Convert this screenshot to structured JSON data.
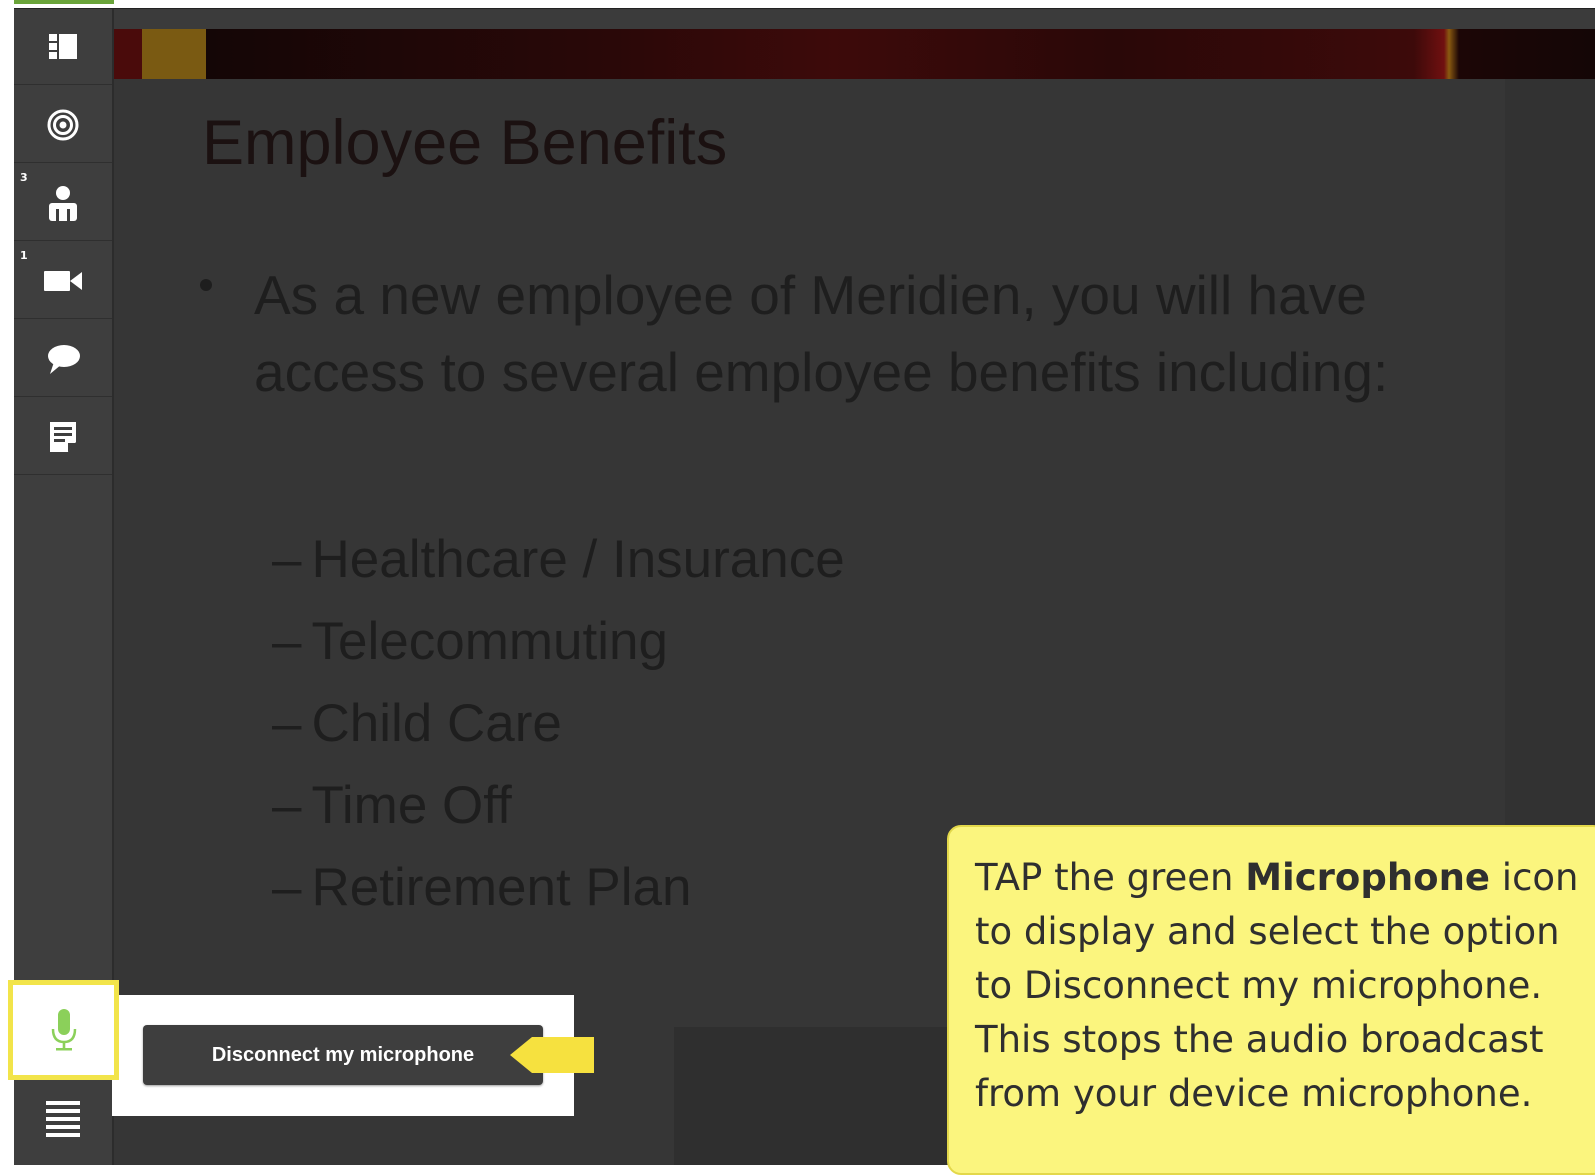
{
  "sidebar": {
    "items": [
      {
        "name": "layout-icon",
        "badge": ""
      },
      {
        "name": "target-icon",
        "badge": ""
      },
      {
        "name": "attendees-icon",
        "badge": "3"
      },
      {
        "name": "camera-icon",
        "badge": "1"
      },
      {
        "name": "chat-bubble-icon",
        "badge": ""
      },
      {
        "name": "notes-icon",
        "badge": ""
      }
    ],
    "mic_icon": "microphone-icon",
    "mic_color": "#8bd05a",
    "menu_icon": "hamburger-menu-icon"
  },
  "slide": {
    "title": "Employee Benefits",
    "bullet": "As a new employee of Meridien, you will have access to several employee benefits including:",
    "sub_items": [
      "Healthcare / Insurance",
      "Telecommuting",
      "Child Care",
      "Time Off",
      "Retirement Plan"
    ],
    "dash": "–"
  },
  "mic_popup": {
    "disconnect_label": "Disconnect my microphone"
  },
  "callout": {
    "text_before": "TAP the green ",
    "bold": "Microphone",
    "text_after": " icon to display and select the option to Disconnect my microphone. This stops the audio broadcast from your device microphone."
  },
  "colors": {
    "highlight_border": "#f2e44a",
    "callout_background": "#fbf57e",
    "sidebar_background": "#3e3e3e"
  }
}
